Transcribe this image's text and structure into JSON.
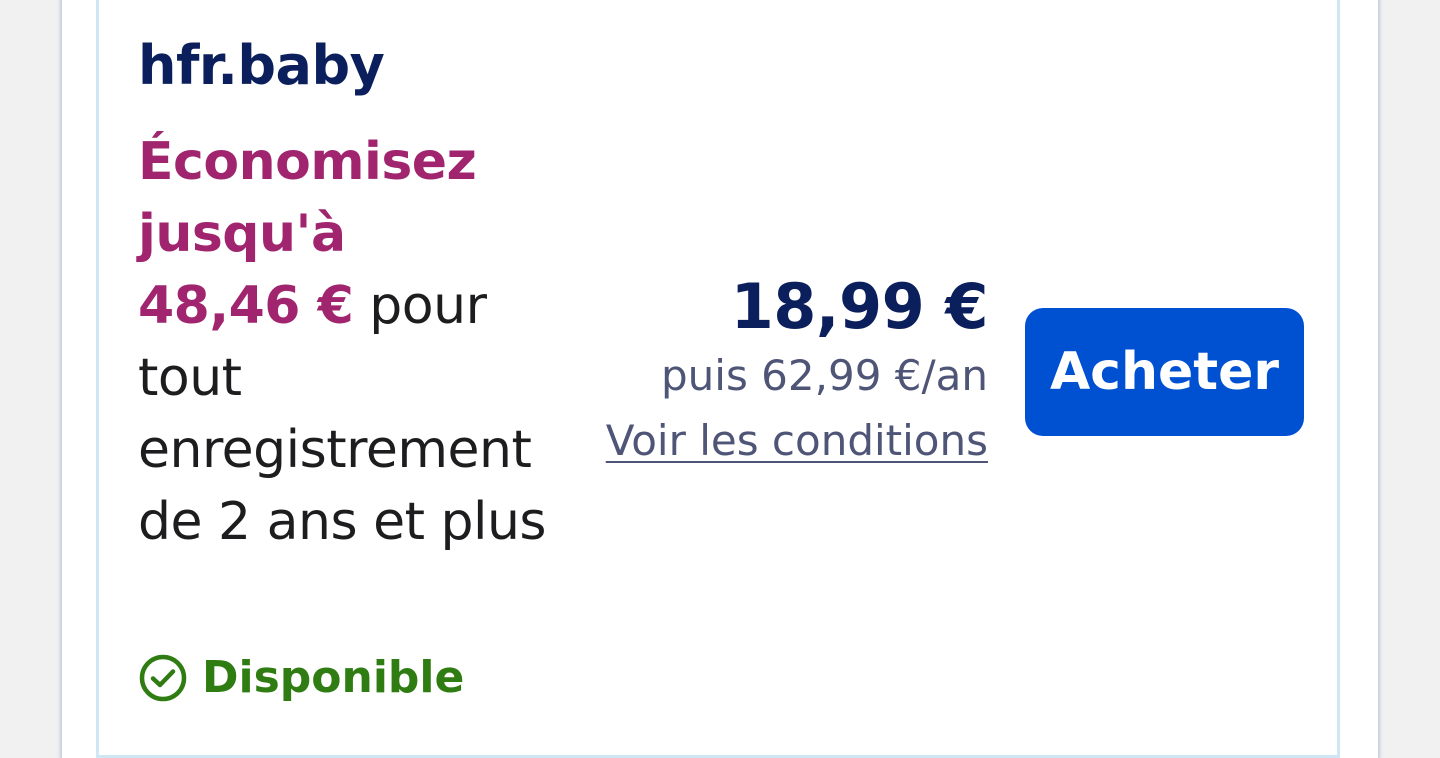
{
  "offer": {
    "domain_name": "hfr.baby",
    "promo": {
      "prefix": "Économisez jusqu'à",
      "amount": "48,46 €",
      "suffix": " pour tout enregistrement de 2 ans et plus"
    },
    "price": "18,99 €",
    "renewal": "puis 62,99 €/an",
    "conditions_link": "Voir les conditions",
    "buy_label": "Acheter",
    "availability": "Disponible"
  },
  "colors": {
    "domain_text": "#0b1f5c",
    "promo_highlight": "#a0246e",
    "button_bg": "#0050d2",
    "available_green": "#2f7d12"
  },
  "icons": {
    "availability_icon": "check-circle-icon"
  }
}
